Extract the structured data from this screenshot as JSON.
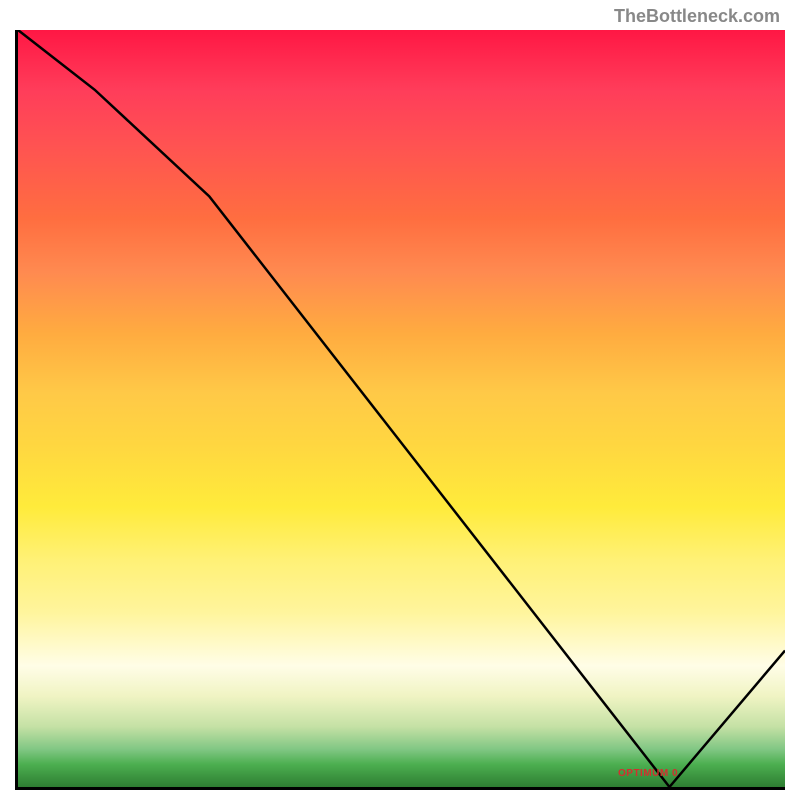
{
  "watermark": "TheBottleneck.com",
  "chart_data": {
    "type": "line",
    "title": "",
    "xlabel": "",
    "ylabel": "",
    "x": [
      0,
      10,
      25,
      85,
      100
    ],
    "values": [
      100,
      92,
      78,
      0,
      18
    ],
    "xlim": [
      0,
      100
    ],
    "ylim": [
      0,
      100
    ],
    "annotation_label": "OPTIMUM 0",
    "annotation_position": {
      "x": 82,
      "y": 2
    },
    "gradient_theme": "bottleneck-gauge",
    "note": "Background gradient from red (top, high bottleneck) through orange/yellow to green (bottom, no bottleneck). Line shows bottleneck curve descending to minimum around x=85."
  }
}
